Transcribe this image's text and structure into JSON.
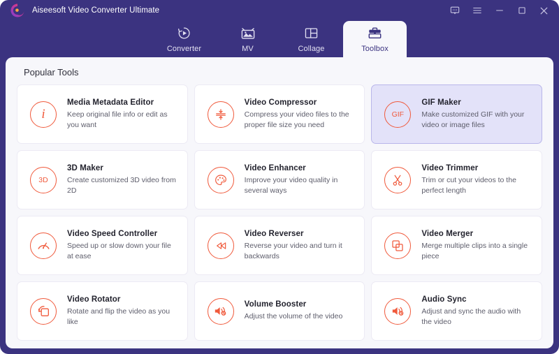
{
  "window": {
    "title": "Aiseesoft Video Converter Ultimate",
    "logo_icon": "aiseesoft-swirl-logo",
    "controls": [
      {
        "name": "feedback-icon",
        "label": "Feedback"
      },
      {
        "name": "menu-icon",
        "label": "Menu"
      },
      {
        "name": "minimize-icon",
        "label": "Minimize"
      },
      {
        "name": "maximize-icon",
        "label": "Maximize"
      },
      {
        "name": "close-icon",
        "label": "Close"
      }
    ]
  },
  "tabs": [
    {
      "label": "Converter",
      "icon": "converter-icon",
      "active": false
    },
    {
      "label": "MV",
      "icon": "mv-icon",
      "active": false
    },
    {
      "label": "Collage",
      "icon": "collage-icon",
      "active": false
    },
    {
      "label": "Toolbox",
      "icon": "toolbox-icon",
      "active": true
    }
  ],
  "main": {
    "section_title": "Popular Tools",
    "tools": [
      {
        "title": "Media Metadata Editor",
        "desc": "Keep original file info or edit as you want",
        "icon": "info-icon",
        "highlighted": false
      },
      {
        "title": "Video Compressor",
        "desc": "Compress your video files to the proper file size you need",
        "icon": "compress-icon",
        "highlighted": false
      },
      {
        "title": "GIF Maker",
        "desc": "Make customized GIF with your video or image files",
        "icon": "gif-icon",
        "highlighted": true
      },
      {
        "title": "3D Maker",
        "desc": "Create customized 3D video from 2D",
        "icon": "3d-icon",
        "highlighted": false
      },
      {
        "title": "Video Enhancer",
        "desc": "Improve your video quality in several ways",
        "icon": "palette-icon",
        "highlighted": false
      },
      {
        "title": "Video Trimmer",
        "desc": "Trim or cut your videos to the perfect length",
        "icon": "scissors-icon",
        "highlighted": false
      },
      {
        "title": "Video Speed Controller",
        "desc": "Speed up or slow down your file at ease",
        "icon": "speedometer-icon",
        "highlighted": false
      },
      {
        "title": "Video Reverser",
        "desc": "Reverse your video and turn it backwards",
        "icon": "rewind-icon",
        "highlighted": false
      },
      {
        "title": "Video Merger",
        "desc": "Merge multiple clips into a single piece",
        "icon": "merge-squares-icon",
        "highlighted": false
      },
      {
        "title": "Video Rotator",
        "desc": "Rotate and flip the video as you like",
        "icon": "rotate-icon",
        "highlighted": false
      },
      {
        "title": "Volume Booster",
        "desc": "Adjust the volume of the video",
        "icon": "volume-icon",
        "highlighted": false
      },
      {
        "title": "Audio Sync",
        "desc": "Adjust and sync the audio with the video",
        "icon": "audio-sync-icon",
        "highlighted": false
      }
    ]
  },
  "colors": {
    "window_frame": "#3b3380",
    "panel_background": "#f7f7fb",
    "accent_orange": "#f05a3c",
    "highlight_card": "#e3e2f9",
    "highlight_border": "#b9b6ea"
  }
}
